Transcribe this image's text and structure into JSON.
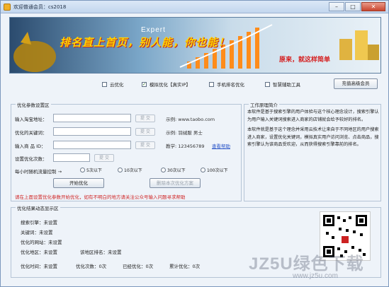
{
  "window": {
    "title": "欢迎普通会员：cs2018"
  },
  "banner": {
    "slogan": "排名直上首页，别人能，你也能！",
    "expert": "Expert",
    "sub_slogan": "原来，就这样简单"
  },
  "options": [
    {
      "label": "云优化",
      "checked": false
    },
    {
      "label": "模拟优化【真实IP】",
      "checked": true
    },
    {
      "label": "手机排名优化",
      "checked": false
    },
    {
      "label": "智慧辅助工具",
      "checked": false
    }
  ],
  "member_button": "充值高级会员",
  "settings": {
    "group_title": "优化参数设置区",
    "rows": [
      {
        "label": "输入淘宝地址：",
        "button": "提 交",
        "example": "示例: www.taobo.com",
        "link": ""
      },
      {
        "label": "优化的关键词：",
        "button": "提 交",
        "example": "示例: 羽绒服 男士",
        "link": ""
      },
      {
        "label": "输入商 品 ID：",
        "button": "提 交",
        "example": "教学: 123456789",
        "link": "查看帮助"
      },
      {
        "label": "设置优化次数：",
        "button": "提 交",
        "example": "",
        "link": ""
      }
    ],
    "flow_label": "每小时随机流量控制 →",
    "radios": [
      "5次以下",
      "10次以下",
      "30次以下",
      "100次以下"
    ],
    "start_button": "开始优化",
    "plan_button": "删除本次优化方案",
    "warning": "请在上面设置优化参数开始优化，如有不明白的地方请关注公众号输入问题寻求帮助"
  },
  "intro": {
    "group_title": "工作原理简介",
    "paragraphs": [
      "本软件是基于搜索引擎的用户体验与这个核心理念设计，搜索引擎认为用户输入关键词搜索进入商家的店铺就会给予较好的排名。",
      "本软件就是基于这个理念并采用云技术让来自于不同地区的用户搜索进入商家，设置优化关键词，模拟真实用户访问浏览、点击商品，搜索引擎认为该商品受欢迎，从而获得搜索引擎靠前的排名。"
    ]
  },
  "results": {
    "group_title": "优化结果动态显示区",
    "rows": [
      [
        "搜索引擎：未设置"
      ],
      [
        "关键词：未设置"
      ],
      [
        "优化的网站：未设置"
      ],
      [
        "优化地区：未设置",
        "该地区排名：未设置"
      ],
      [
        "优化时间：未设置",
        "优化次数：0次",
        "已经优化：0次",
        "累计优化：0次"
      ]
    ]
  },
  "watermark": "JZ5U绿色下载",
  "watermark_url": "www.jz5u.com"
}
